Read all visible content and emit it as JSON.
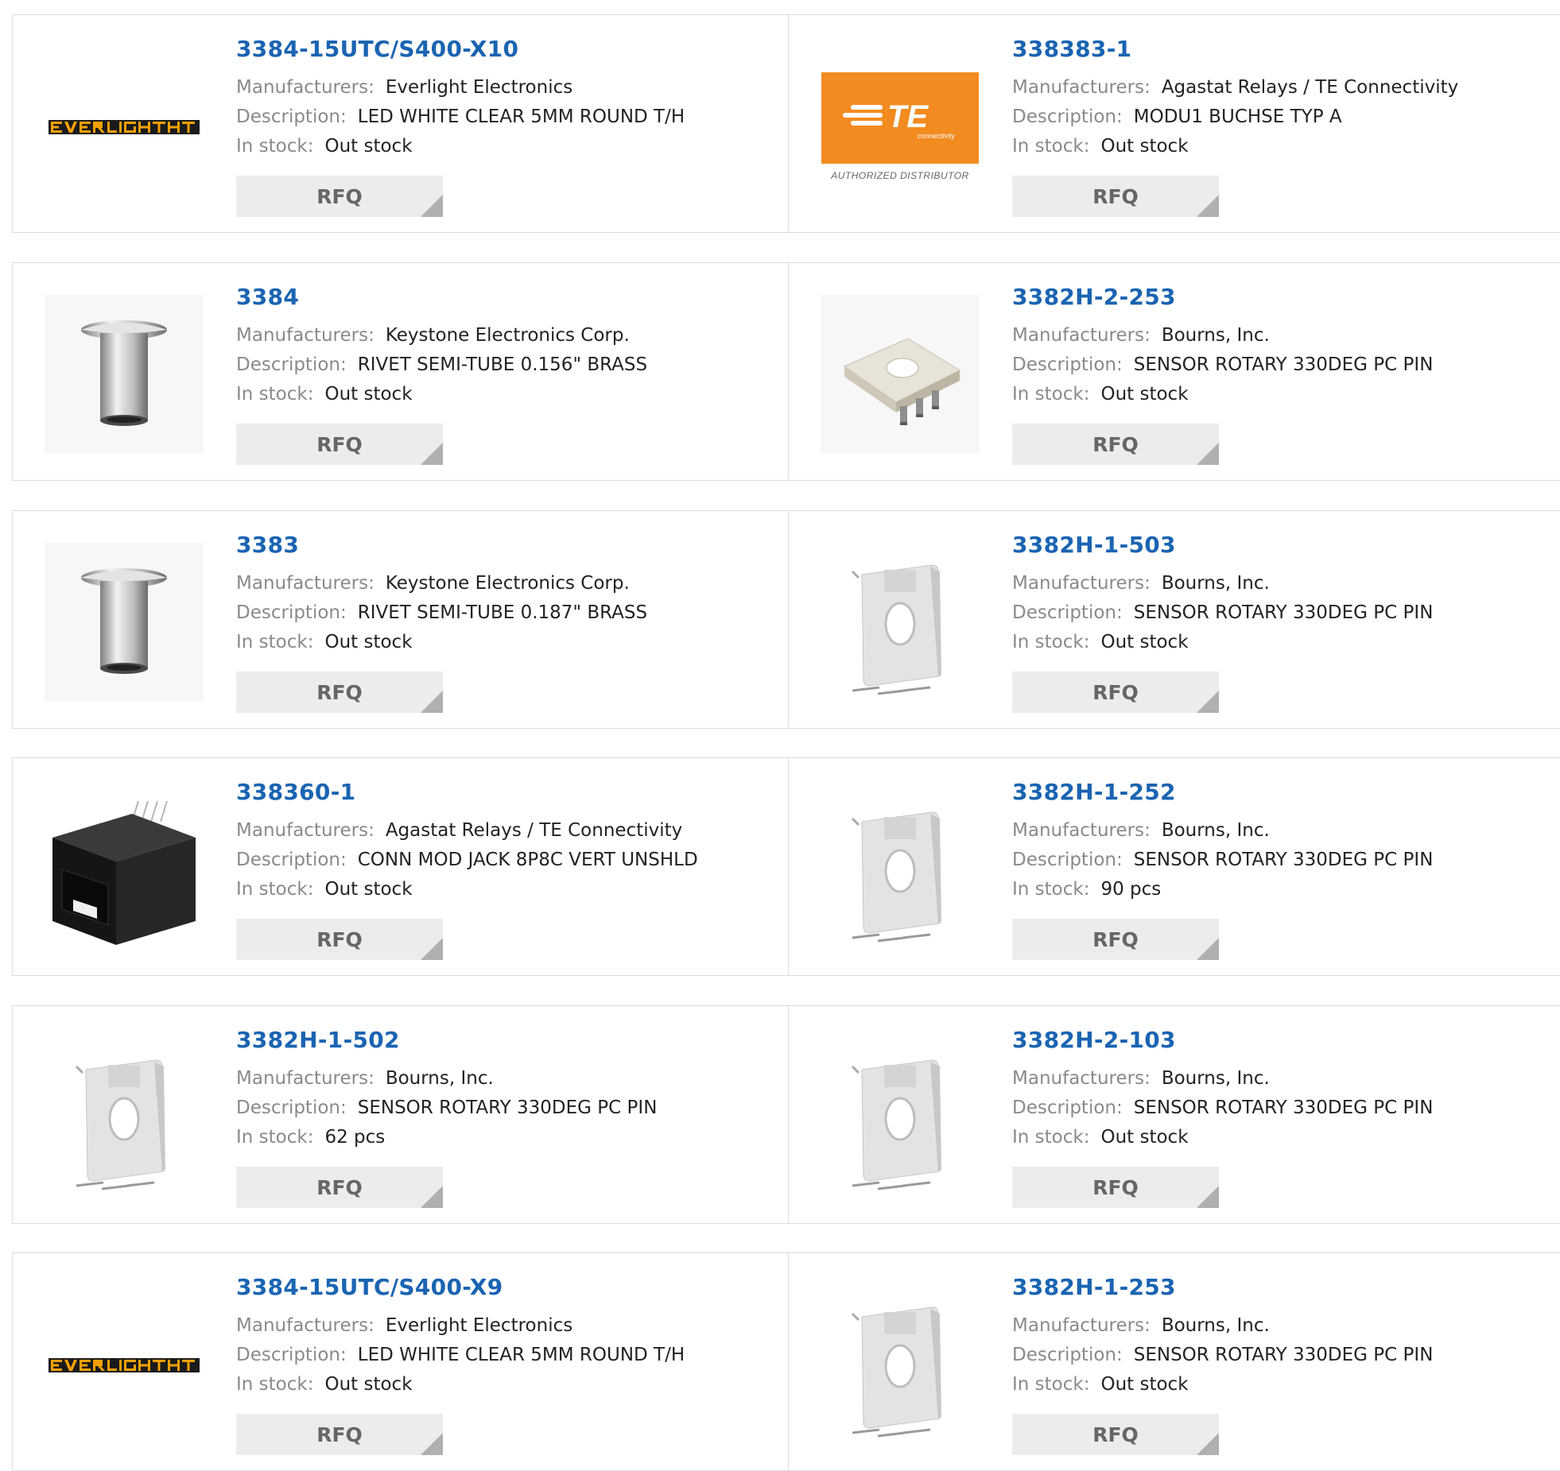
{
  "labels": {
    "manufacturers": "Manufacturers:",
    "description": "Description:",
    "stock": "In stock:",
    "rfq": "RFQ"
  },
  "products": [
    {
      "part": "3384-15UTC/S400-X10",
      "manufacturer": "Everlight Electronics",
      "description": "LED WHITE CLEAR 5MM ROUND T/H",
      "stock": "Out stock",
      "image": "everlight-logo"
    },
    {
      "part": "338383-1",
      "manufacturer": "Agastat Relays / TE Connectivity",
      "description": "MODU1 BUCHSE TYP A",
      "stock": "Out stock",
      "image": "te-logo",
      "logo_text": "TE",
      "logo_sub": "connectivity",
      "logo_caption": "AUTHORIZED DISTRIBUTOR"
    },
    {
      "part": "3384",
      "manufacturer": "Keystone Electronics Corp.",
      "description": "RIVET SEMI-TUBE 0.156\" BRASS",
      "stock": "Out stock",
      "image": "rivet"
    },
    {
      "part": "3382H-2-253",
      "manufacturer": "Bourns, Inc.",
      "description": "SENSOR ROTARY 330DEG PC PIN",
      "stock": "Out stock",
      "image": "sensor-flat"
    },
    {
      "part": "3383",
      "manufacturer": "Keystone Electronics Corp.",
      "description": "RIVET SEMI-TUBE 0.187\" BRASS",
      "stock": "Out stock",
      "image": "rivet"
    },
    {
      "part": "3382H-1-503",
      "manufacturer": "Bourns, Inc.",
      "description": "SENSOR ROTARY 330DEG PC PIN",
      "stock": "Out stock",
      "image": "sensor-upright"
    },
    {
      "part": "338360-1",
      "manufacturer": "Agastat Relays / TE Connectivity",
      "description": "CONN MOD JACK 8P8C VERT UNSHLD",
      "stock": "Out stock",
      "image": "modular-jack"
    },
    {
      "part": "3382H-1-252",
      "manufacturer": "Bourns, Inc.",
      "description": "SENSOR ROTARY 330DEG PC PIN",
      "stock": "90 pcs",
      "image": "sensor-upright"
    },
    {
      "part": "3382H-1-502",
      "manufacturer": "Bourns, Inc.",
      "description": "SENSOR ROTARY 330DEG PC PIN",
      "stock": "62 pcs",
      "image": "sensor-upright"
    },
    {
      "part": "3382H-2-103",
      "manufacturer": "Bourns, Inc.",
      "description": "SENSOR ROTARY 330DEG PC PIN",
      "stock": "Out stock",
      "image": "sensor-upright"
    },
    {
      "part": "3384-15UTC/S400-X9",
      "manufacturer": "Everlight Electronics",
      "description": "LED WHITE CLEAR 5MM ROUND T/H",
      "stock": "Out stock",
      "image": "everlight-logo"
    },
    {
      "part": "3382H-1-253",
      "manufacturer": "Bourns, Inc.",
      "description": "SENSOR ROTARY 330DEG PC PIN",
      "stock": "Out stock",
      "image": "sensor-upright"
    }
  ],
  "colors": {
    "part_link": "#1a64b2",
    "label": "#8a8a8a",
    "rfq_bg": "#ececec",
    "te_orange": "#f28b20",
    "everlight_orange": "#f5a000"
  }
}
